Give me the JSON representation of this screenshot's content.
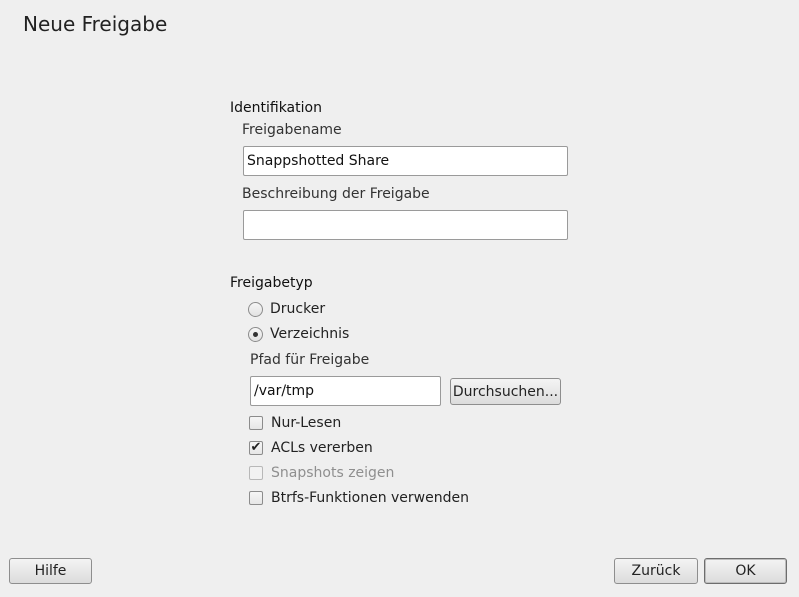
{
  "dialog": {
    "title": "Neue Freigabe"
  },
  "identification": {
    "heading": "Identifikation",
    "share_name_label": "Freigabename",
    "share_name_value": "Snappshotted Share",
    "description_label": "Beschreibung der Freigabe",
    "description_value": ""
  },
  "share_type": {
    "heading": "Freigabetyp",
    "options": [
      {
        "label": "Drucker",
        "selected": false
      },
      {
        "label": "Verzeichnis",
        "selected": true
      }
    ],
    "path_label": "Pfad für Freigabe",
    "path_value": "/var/tmp",
    "browse_label": "Durchsuchen..."
  },
  "options": [
    {
      "label": "Nur-Lesen",
      "checked": false,
      "enabled": true
    },
    {
      "label": "ACLs vererben",
      "checked": true,
      "enabled": true
    },
    {
      "label": "Snapshots zeigen",
      "checked": false,
      "enabled": false
    },
    {
      "label": "Btrfs-Funktionen verwenden",
      "checked": false,
      "enabled": true
    }
  ],
  "footer": {
    "help_label": "Hilfe",
    "back_label": "Zurück",
    "ok_label": "OK"
  }
}
